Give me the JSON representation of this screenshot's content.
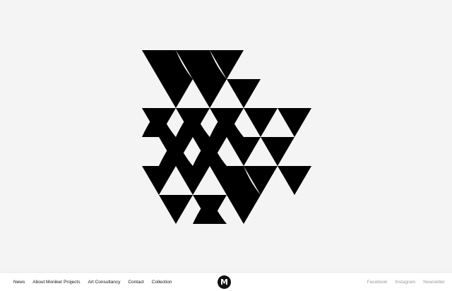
{
  "nav": {
    "left": [
      {
        "label": "News"
      },
      {
        "label": "About Moniker Projects"
      },
      {
        "label": "Art Consultancy"
      },
      {
        "label": "Contact"
      },
      {
        "label": "Collection"
      }
    ],
    "right": [
      {
        "label": "Facebook"
      },
      {
        "label": "Instagram"
      },
      {
        "label": "Newsletter"
      }
    ]
  },
  "logo": {
    "letter": "M",
    "icon": "moniker-logo-icon"
  },
  "artwork": {
    "icon": "triangle-pattern-artwork",
    "colors": {
      "ink": "#000000",
      "background": "#f4f4f4"
    }
  }
}
